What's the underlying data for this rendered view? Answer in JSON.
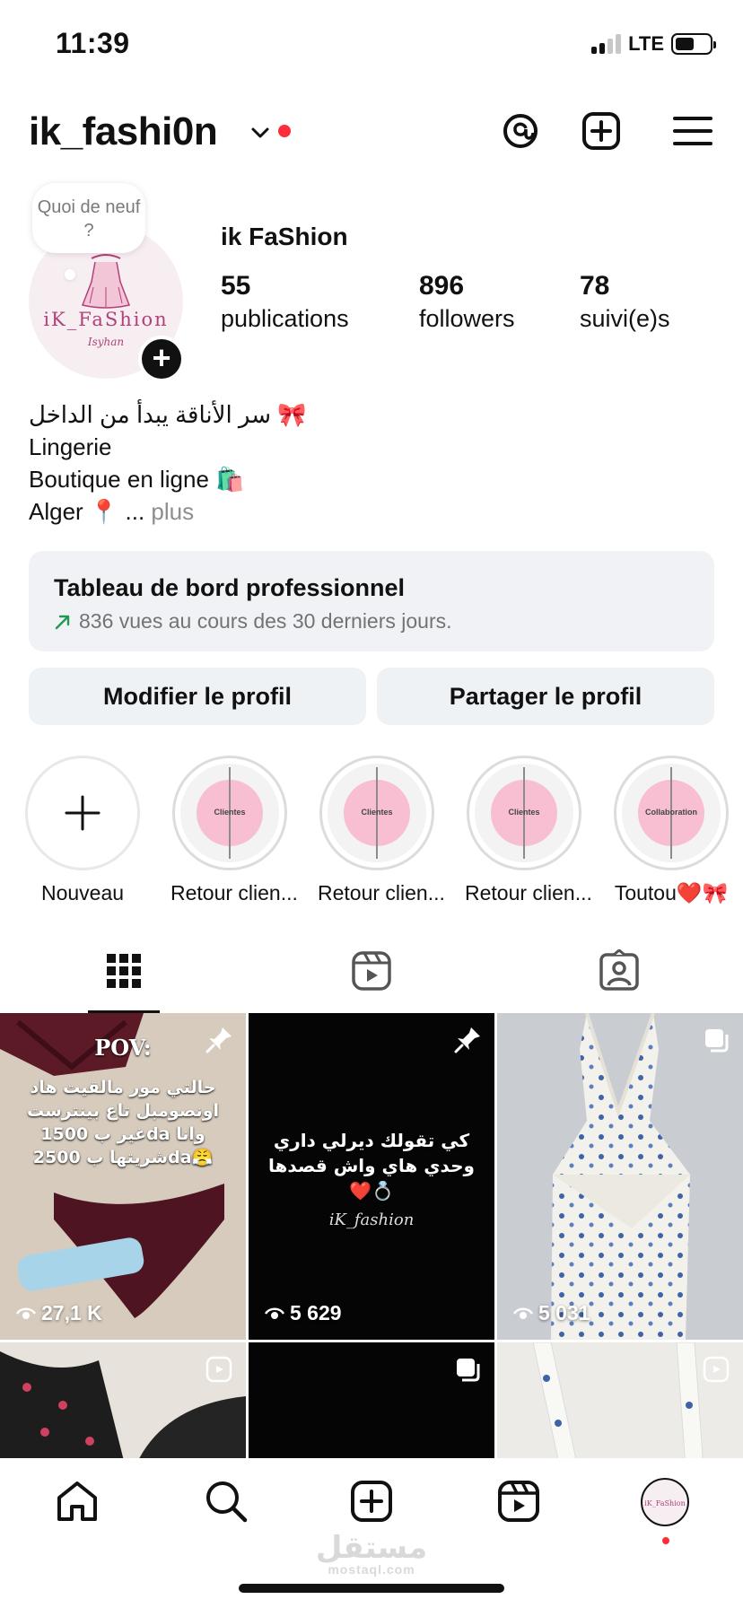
{
  "status_bar": {
    "time": "11:39",
    "network": "LTE"
  },
  "header": {
    "username": "ik_fashi0n"
  },
  "profile": {
    "bubble_text": "Quoi de neuf ?",
    "avatar_brand": "iK_FaShion",
    "avatar_brand_sub": "Isyhan",
    "display_name": "ik FaShion",
    "stats": [
      {
        "value": "55",
        "label": "publications"
      },
      {
        "value": "896",
        "label": "followers"
      },
      {
        "value": "78",
        "label": "suivi(e)s"
      }
    ],
    "bio": {
      "line1": "سر الأناقة يبدأ من الداخل 🎀",
      "line2": "Lingerie",
      "line3": "Boutique en ligne 🛍️",
      "line4": "Alger 📍 ...",
      "more": "plus"
    }
  },
  "dashboard": {
    "title": "Tableau de bord professionnel",
    "subtitle": "836 vues au cours des 30 derniers jours."
  },
  "buttons": {
    "edit": "Modifier le profil",
    "share": "Partager le profil"
  },
  "highlights": [
    {
      "label": "Nouveau"
    },
    {
      "label": "Retour clien...",
      "tag": "Clientes"
    },
    {
      "label": "Retour clien...",
      "tag": "Clientes"
    },
    {
      "label": "Retour clien...",
      "tag": "Clientes"
    },
    {
      "label": "Toutou❤️🎀",
      "tag": "Collaboration"
    }
  ],
  "posts": [
    {
      "views": "27,1 K",
      "overlay_title": "POV:",
      "overlay_text": "حالتي مور مالقيت هاد اونصومبل تاع بينترست غير ب 1500da وانا شريتها ب 2500da😤"
    },
    {
      "views": "5 629",
      "overlay_text": "كي تقولك ديرلي داري وحدي هاي واش قصدها❤️💍",
      "overlay_brand": "iK_fashion"
    },
    {
      "views": "5 031"
    }
  ],
  "watermark": {
    "arabic": "مستقل",
    "latin": "mostaql.com"
  },
  "colors": {
    "notification_red": "#ff2d3a",
    "button_bg": "#eff2f5",
    "trend_green": "#1f9a54",
    "brand_pink": "#b2407a"
  }
}
